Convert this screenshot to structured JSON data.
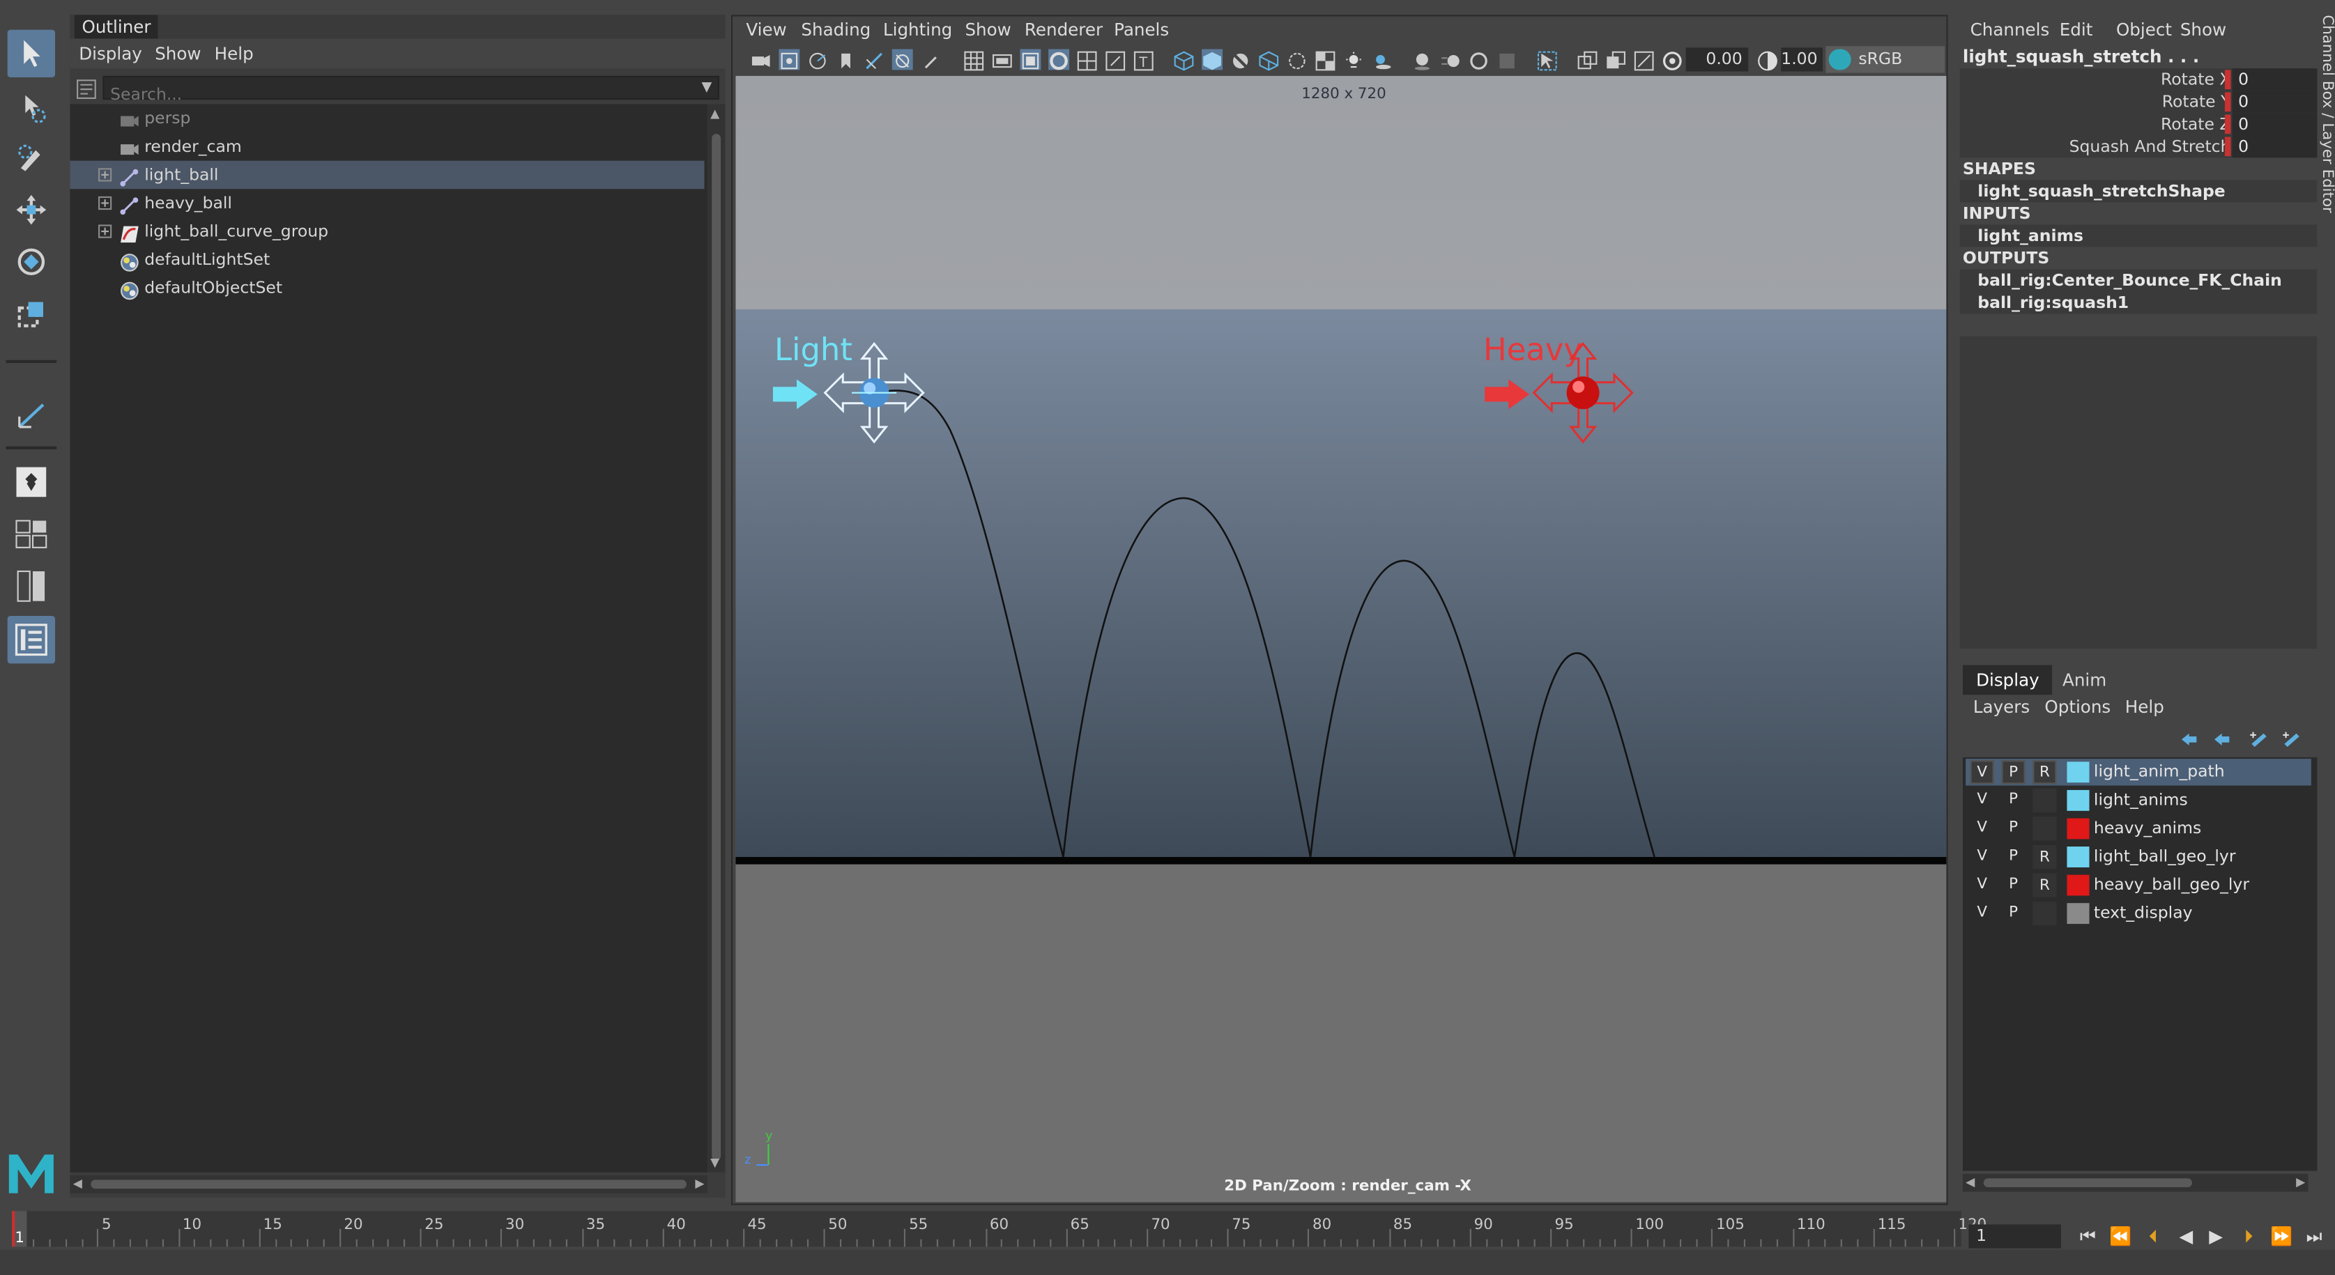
{
  "outliner": {
    "tab_label": "Outliner",
    "menu": [
      "Display",
      "Show",
      "Help"
    ],
    "search_placeholder": "Search...",
    "items": [
      {
        "label": "persp",
        "icon": "camera-icon",
        "dim": true,
        "expandable": false
      },
      {
        "label": "render_cam",
        "icon": "camera-icon",
        "dim": false,
        "expandable": false
      },
      {
        "label": "light_ball",
        "icon": "joint-icon",
        "dim": false,
        "expandable": true,
        "selected": true
      },
      {
        "label": "heavy_ball",
        "icon": "joint-icon",
        "dim": false,
        "expandable": true
      },
      {
        "label": "light_ball_curve_group",
        "icon": "curve-group-icon",
        "dim": false,
        "expandable": true
      },
      {
        "label": "defaultLightSet",
        "icon": "set-icon",
        "dim": false,
        "expandable": false
      },
      {
        "label": "defaultObjectSet",
        "icon": "set-icon",
        "dim": false,
        "expandable": false
      }
    ]
  },
  "viewport": {
    "menu": [
      "View",
      "Shading",
      "Lighting",
      "Show",
      "Renderer",
      "Panels"
    ],
    "exposure_value": "0.00",
    "gamma_value": "1.00",
    "color_space": "sRGB gamma",
    "resolution_label": "1280 x 720",
    "light_label": "Light",
    "heavy_label": "Heavy",
    "pan_zoom_label": "2D Pan/Zoom : render_cam -X",
    "axis_y": "y",
    "axis_z": "z",
    "colors": {
      "light": "#6fe3f5",
      "heavy": "#e8383a",
      "stage_top": "#7b8a9e",
      "stage_bottom": "#3e4a57"
    }
  },
  "channelbox": {
    "menu": [
      "Channels",
      "Edit",
      "Object",
      "Show"
    ],
    "node_title": "light_squash_stretch . . .",
    "attributes": [
      {
        "name": "Rotate X",
        "value": "0"
      },
      {
        "name": "Rotate Y",
        "value": "0"
      },
      {
        "name": "Rotate Z",
        "value": "0"
      },
      {
        "name": "Squash And Stretch",
        "value": "0"
      }
    ],
    "shapes_header": "SHAPES",
    "shapes": [
      "light_squash_stretchShape"
    ],
    "inputs_header": "INPUTS",
    "inputs": [
      "light_anims"
    ],
    "outputs_header": "OUTPUTS",
    "outputs": [
      "ball_rig:Center_Bounce_FK_Chain",
      "ball_rig:squash1"
    ],
    "side_tab": "Channel Box / Layer Editor"
  },
  "layers": {
    "tabs": [
      "Display",
      "Anim"
    ],
    "menu": [
      "Layers",
      "Options",
      "Help"
    ],
    "rows": [
      {
        "v": "V",
        "p": "P",
        "r": "R",
        "color": "#6fd3ef",
        "name": "light_anim_path",
        "selected": true
      },
      {
        "v": "V",
        "p": "P",
        "r": "",
        "color": "#6fd3ef",
        "name": "light_anims"
      },
      {
        "v": "V",
        "p": "P",
        "r": "",
        "color": "#e01818",
        "name": "heavy_anims"
      },
      {
        "v": "V",
        "p": "P",
        "r": "R",
        "color": "#6fd3ef",
        "name": "light_ball_geo_lyr"
      },
      {
        "v": "V",
        "p": "P",
        "r": "R",
        "color": "#e01818",
        "name": "heavy_ball_geo_lyr"
      },
      {
        "v": "V",
        "p": "P",
        "r": "",
        "color": "#8a8a8a",
        "name": "text_display"
      }
    ]
  },
  "timeline": {
    "current_frame": "1",
    "ticks": [
      "5",
      "10",
      "15",
      "20",
      "25",
      "30",
      "35",
      "40",
      "45",
      "50",
      "55",
      "60",
      "65",
      "70",
      "75",
      "80",
      "85",
      "90",
      "95",
      "100",
      "105",
      "110",
      "115",
      "120"
    ],
    "frame_field": "1",
    "playback": [
      "go-start-icon",
      "step-back-key-icon",
      "step-back-icon",
      "play-back-icon",
      "play-forward-icon",
      "step-forward-icon",
      "step-forward-key-icon",
      "go-end-icon"
    ]
  }
}
